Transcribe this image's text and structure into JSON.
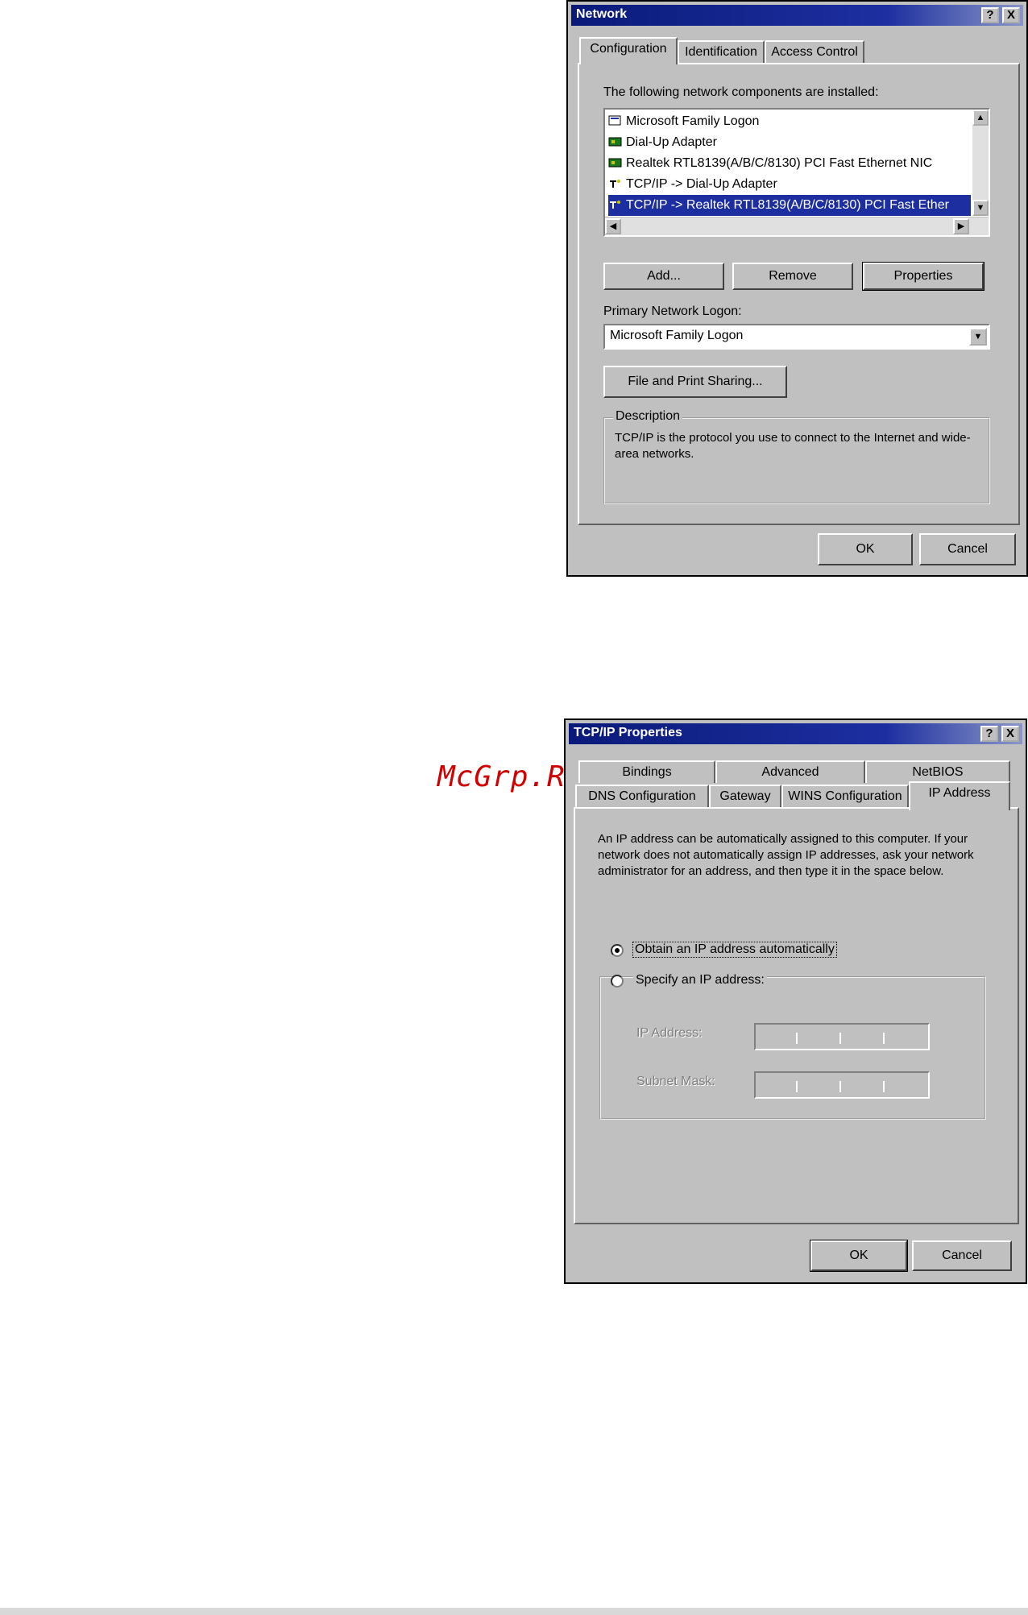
{
  "network_dialog": {
    "title": "Network",
    "help_glyph": "?",
    "close_glyph": "X",
    "tabs": [
      "Configuration",
      "Identification",
      "Access Control"
    ],
    "installed_label": "The following network components are installed:",
    "components": [
      {
        "label": "Microsoft Family Logon",
        "icon": "client-icon"
      },
      {
        "label": "Dial-Up Adapter",
        "icon": "adapter-icon"
      },
      {
        "label": "Realtek RTL8139(A/B/C/8130) PCI Fast Ethernet NIC",
        "icon": "adapter-icon"
      },
      {
        "label": "TCP/IP -> Dial-Up Adapter",
        "icon": "protocol-icon"
      },
      {
        "label": "TCP/IP -> Realtek RTL8139(A/B/C/8130) PCI Fast Ether",
        "icon": "protocol-icon",
        "selected": true
      }
    ],
    "buttons": {
      "add": "Add...",
      "remove": "Remove",
      "properties": "Properties"
    },
    "primary_logon_label": "Primary Network Logon:",
    "primary_logon_value": "Microsoft Family Logon",
    "file_print_button": "File and Print Sharing...",
    "description_label": "Description",
    "description_text": "TCP/IP is the protocol you use to connect to the Internet and wide-area networks.",
    "ok": "OK",
    "cancel": "Cancel"
  },
  "tcpip_dialog": {
    "title": "TCP/IP Properties",
    "help_glyph": "?",
    "close_glyph": "X",
    "tabs_back": [
      "Bindings",
      "Advanced",
      "NetBIOS"
    ],
    "tabs_front": [
      "DNS Configuration",
      "Gateway",
      "WINS Configuration",
      "IP Address"
    ],
    "intro": "An IP address can be automatically assigned to this computer. If your network does not automatically assign IP addresses, ask your network administrator for an address, and then type it in the space below.",
    "radio_auto": "Obtain an IP address automatically",
    "radio_specify": "Specify an IP address:",
    "ip_address_label": "IP Address:",
    "subnet_mask_label": "Subnet Mask:",
    "ok": "OK",
    "cancel": "Cancel"
  },
  "watermark": "McGrp.Ru"
}
